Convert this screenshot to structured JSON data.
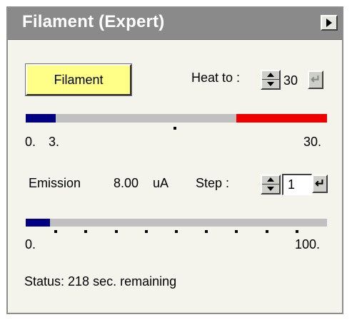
{
  "window": {
    "title": "Filament (Expert)"
  },
  "filament_button": {
    "label": "Filament",
    "color": "#ffff88"
  },
  "heat": {
    "label": "Heat to :",
    "value": "30",
    "enter_icon": "enter-return-icon",
    "enter_enabled": false
  },
  "heat_bar": {
    "current": 3,
    "target": 30,
    "max": 30,
    "labels": {
      "min": "0.",
      "current": "3.",
      "max": "30."
    },
    "current_color": "#000080",
    "target_color": "#ee0000"
  },
  "emission": {
    "label": "Emission",
    "value": "8.00",
    "unit": "uA",
    "step_label": "Step :",
    "step_value": "1",
    "enter_icon": "enter-return-icon",
    "enter_enabled": true
  },
  "emission_bar": {
    "fraction": 0.08,
    "labels": {
      "min": "0.",
      "max": "100."
    },
    "fill_color": "#000080"
  },
  "status": {
    "text": "Status: 218 sec. remaining"
  },
  "icons": {
    "menu": "triangle-right-icon",
    "spinner": "spinner-updown-icon"
  }
}
